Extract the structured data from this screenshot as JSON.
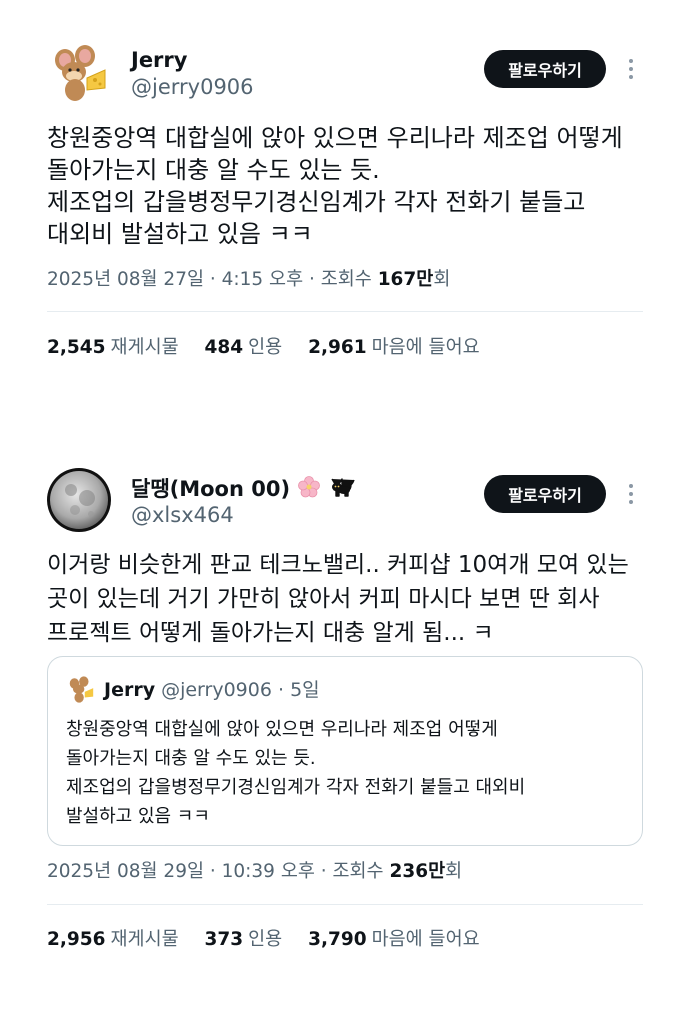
{
  "tweet1": {
    "name": "Jerry",
    "handle": "@jerry0906",
    "follow_label": "팔로우하기",
    "text": "창원중앙역 대합실에 앉아 있으면 우리나라 제조업 어떻게\n돌아가는지 대충 알 수도 있는 듯.\n제조업의 갑을병정무기경신임계가 각자 전화기 붙들고\n대외비 발설하고 있음 ㅋㅋ",
    "meta_prefix": "2025년 08월 27일 · 4:15 오후 · 조회수 ",
    "views": "167만",
    "views_suffix": "회",
    "stats": {
      "retweets": "2,545",
      "retweets_label": "재게시물",
      "quotes": "484",
      "quotes_label": "인용",
      "likes": "2,961",
      "likes_label": "마음에 들어요"
    }
  },
  "tweet2": {
    "name": "달땡(Moon 00)",
    "handle": "@xlsx464",
    "follow_label": "팔로우하기",
    "text": "이거랑 비슷한게 판교 테크노밸리.. 커피샵 10여개 모여 있는\n곳이 있는데 거기 가만히 앉아서 커피 마시다 보면 딴 회사\n프로젝트 어떻게 돌아가는지 대충 알게 됨... ㅋ",
    "quote": {
      "name": "Jerry",
      "handle_time": "@jerry0906 · 5일",
      "text": "창원중앙역 대합실에 앉아 있으면 우리나라 제조업 어떻게\n돌아가는지 대충 알 수도 있는 듯.\n제조업의 갑을병정무기경신임계가 각자 전화기 붙들고 대외비\n발설하고 있음 ㅋㅋ"
    },
    "meta_prefix": "2025년 08월 29일 · 10:39 오후 · 조회수 ",
    "views": "236만",
    "views_suffix": "회",
    "stats": {
      "retweets": "2,956",
      "retweets_label": "재게시물",
      "quotes": "373",
      "quotes_label": "인용",
      "likes": "3,790",
      "likes_label": "마음에 들어요"
    }
  },
  "icons": {
    "more": "more-vertical-icon",
    "flower": "cherry-blossom-icon",
    "cat": "black-cat-icon"
  },
  "colors": {
    "button_bg": "#0f1419",
    "secondary_text": "#536471",
    "border": "#cfd9de"
  }
}
